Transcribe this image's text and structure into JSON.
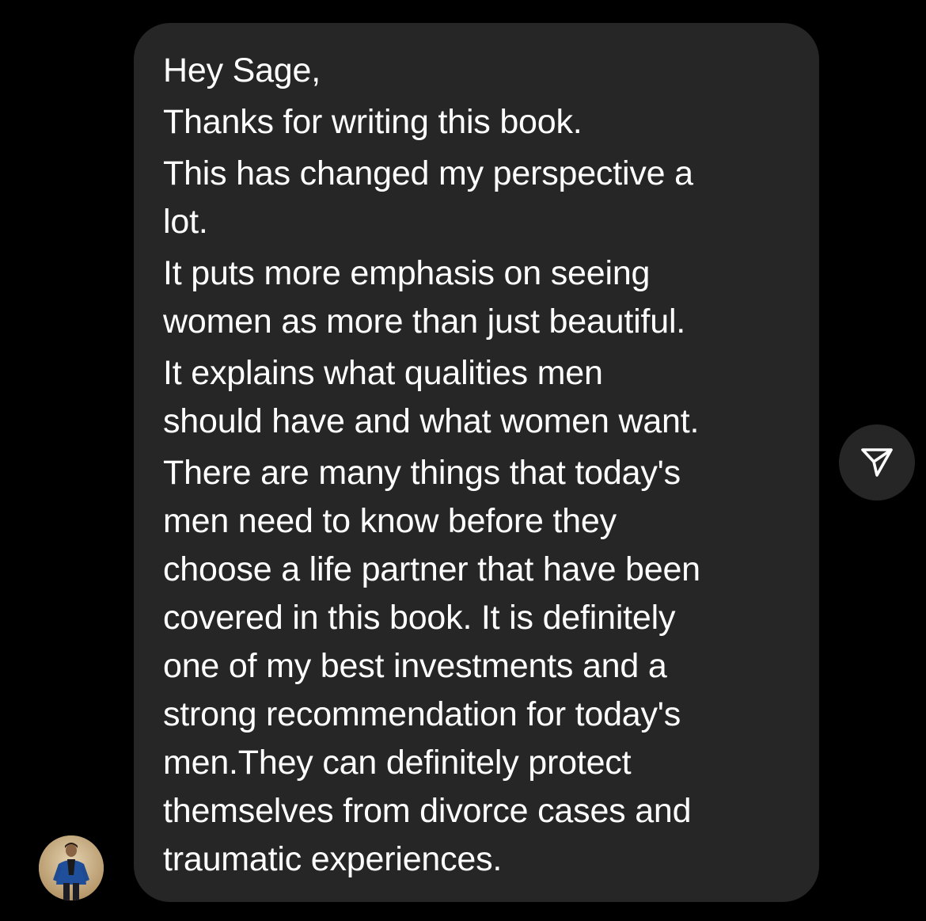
{
  "message": {
    "lines": [
      "Hey Sage,",
      "Thanks for writing this book.",
      "This has changed my perspective a",
      "lot.",
      "It puts more emphasis on seeing",
      "women as more than just beautiful.",
      "It explains what qualities men",
      "should have and what women want.",
      "There are many things that today's",
      "men need to know before they",
      "choose a life partner that have been",
      "covered in this book. It is definitely",
      "one of my best investments and a",
      "strong recommendation for today's",
      "men.They can definitely protect",
      "themselves from divorce cases and",
      "traumatic experiences."
    ]
  },
  "share_button": {
    "icon": "send-icon"
  },
  "sender": {
    "avatar": "avatar"
  },
  "colors": {
    "background": "#000000",
    "bubble": "#262626",
    "text": "#ffffff"
  }
}
